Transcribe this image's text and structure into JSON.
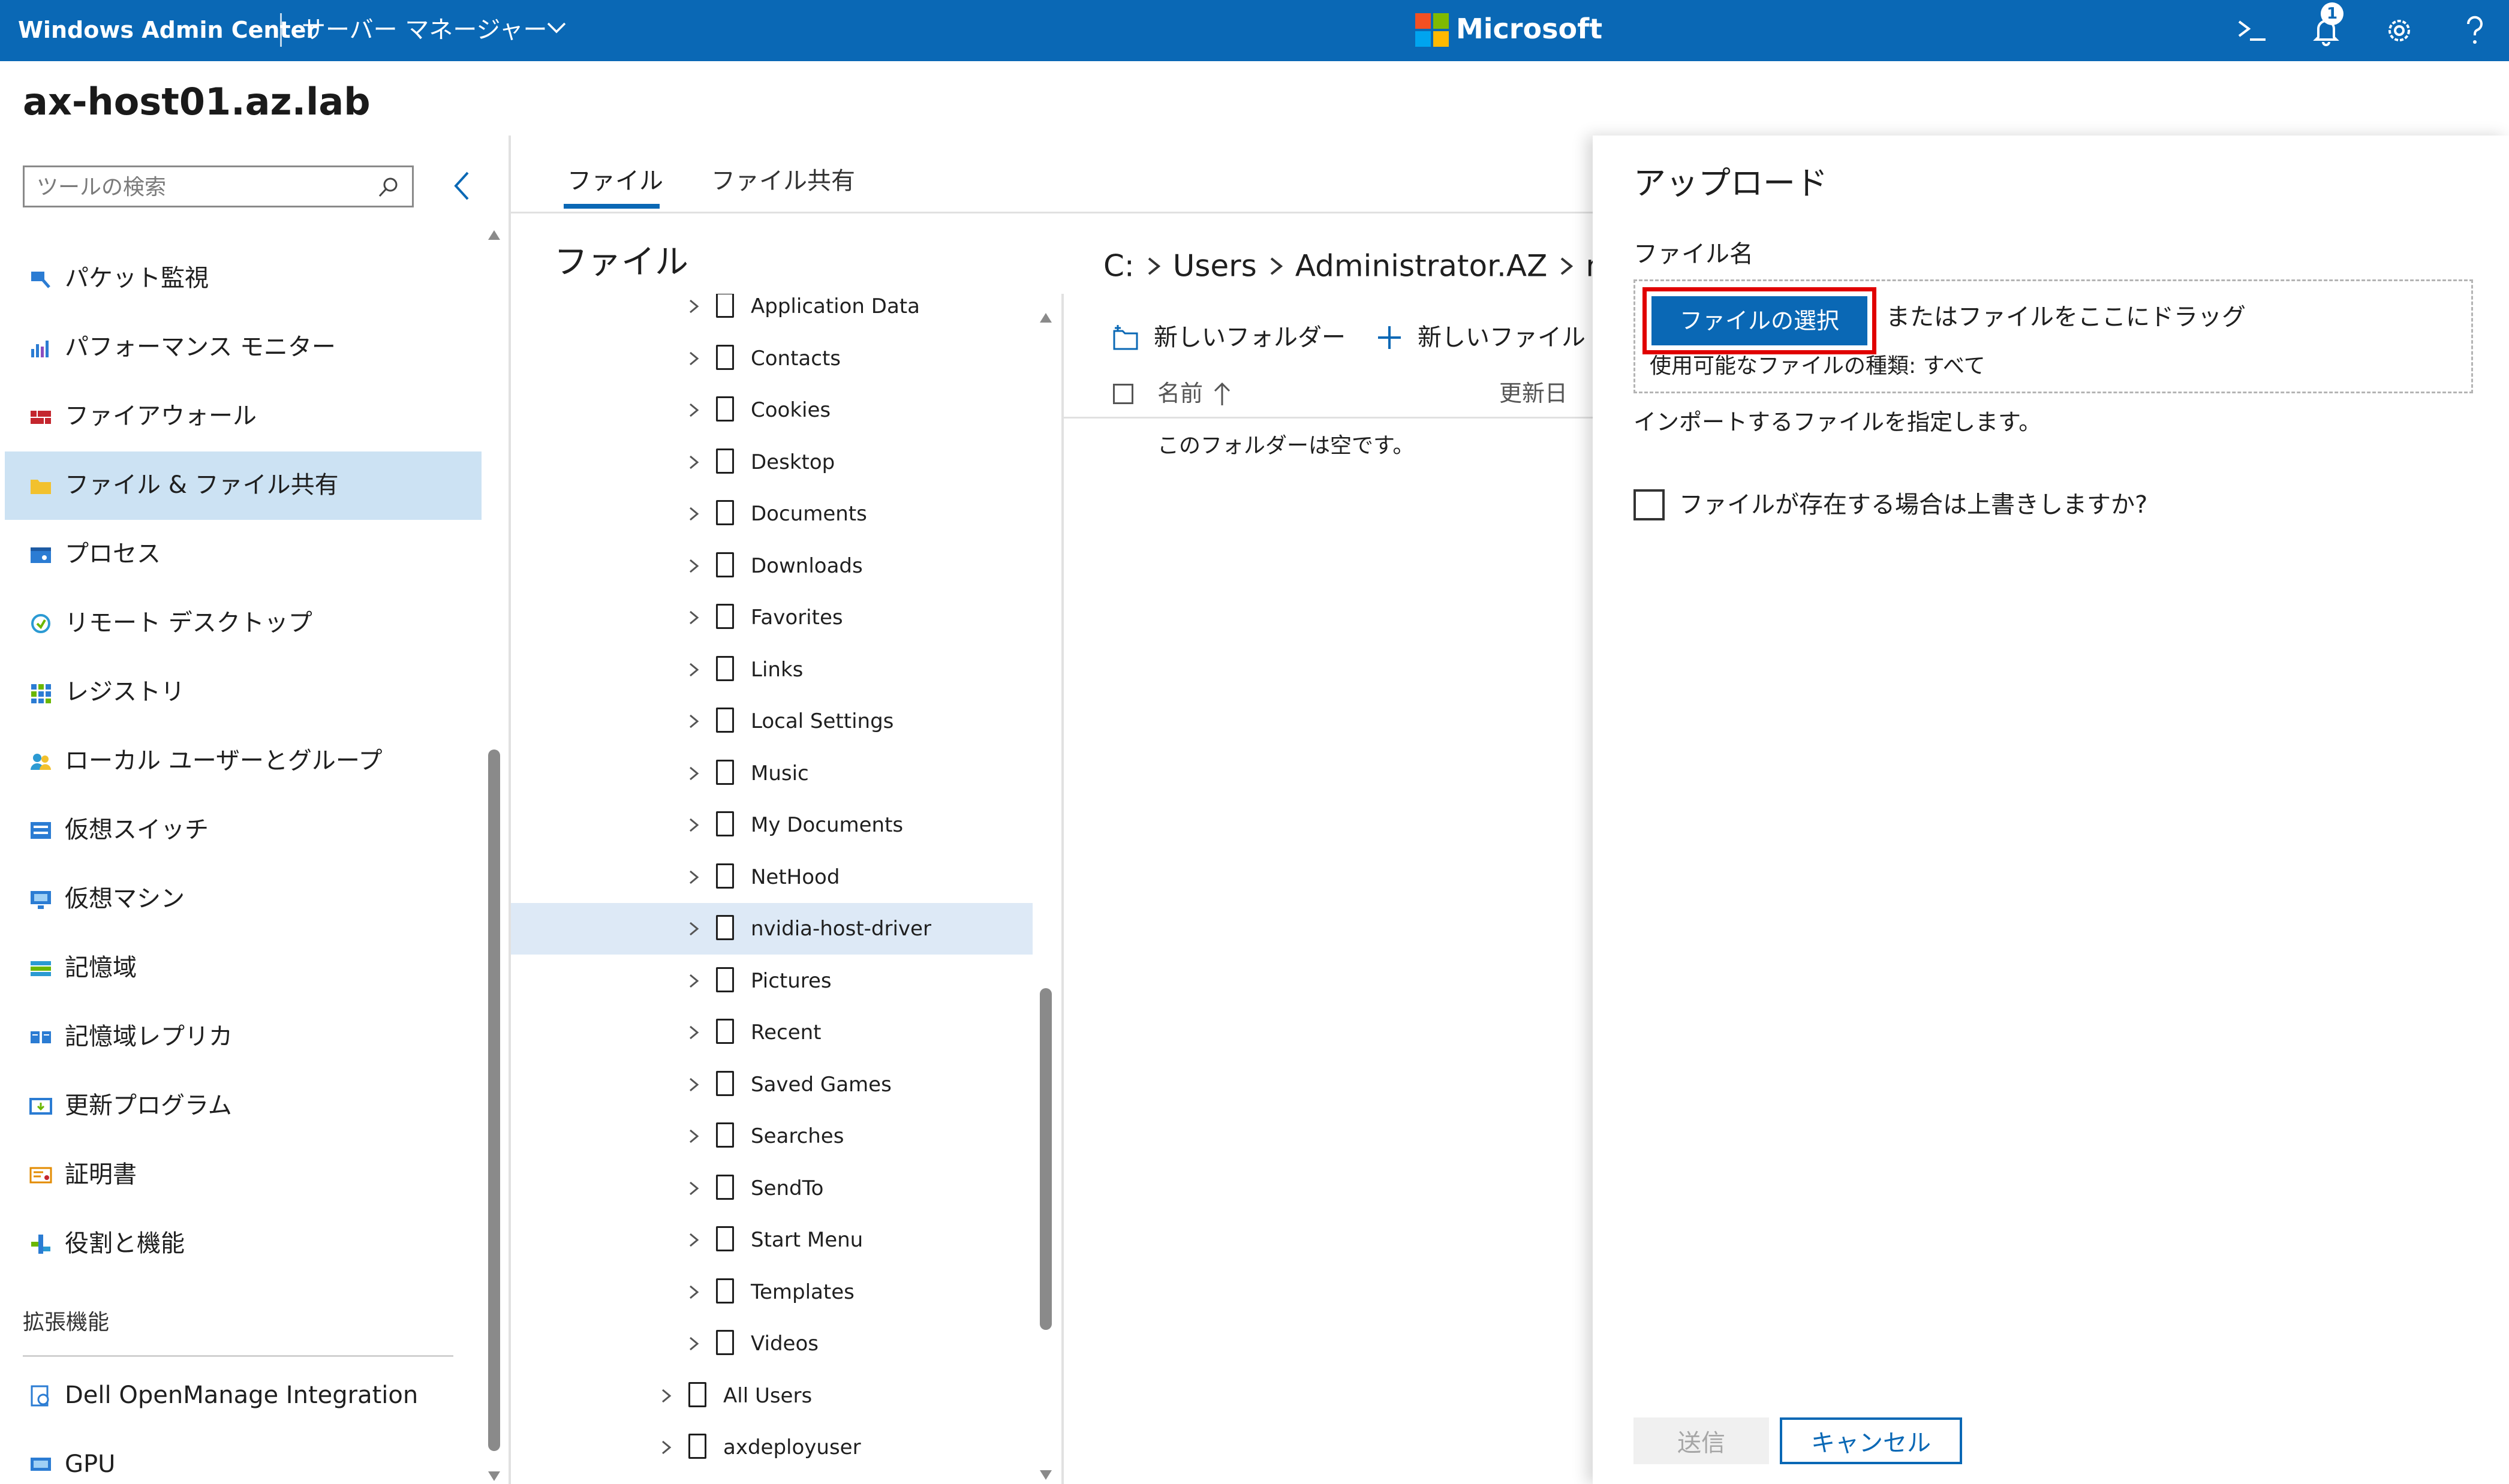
{
  "topbar": {
    "app_title": "Windows Admin Center",
    "context": "サーバー マネージャー",
    "brand": "Microsoft",
    "notification_count": "1",
    "accent": "#0a68b5",
    "icons": [
      "terminal-icon",
      "bell-icon",
      "gear-icon",
      "help-icon"
    ]
  },
  "header": {
    "hostname": "ax-host01.az.lab"
  },
  "sidebar": {
    "search_placeholder": "ツールの検索",
    "items": [
      {
        "label": "パケット監視",
        "icon": "packet-monitor-icon"
      },
      {
        "label": "パフォーマンス モニター",
        "icon": "performance-monitor-icon"
      },
      {
        "label": "ファイアウォール",
        "icon": "firewall-icon"
      },
      {
        "label": "ファイル & ファイル共有",
        "icon": "folder-icon",
        "selected": true
      },
      {
        "label": "プロセス",
        "icon": "process-icon"
      },
      {
        "label": "リモート デスクトップ",
        "icon": "remote-desktop-icon"
      },
      {
        "label": "レジストリ",
        "icon": "registry-icon"
      },
      {
        "label": "ローカル ユーザーとグループ",
        "icon": "users-icon"
      },
      {
        "label": "仮想スイッチ",
        "icon": "virtual-switch-icon"
      },
      {
        "label": "仮想マシン",
        "icon": "virtual-machine-icon"
      },
      {
        "label": "記憶域",
        "icon": "storage-icon"
      },
      {
        "label": "記憶域レプリカ",
        "icon": "storage-replica-icon"
      },
      {
        "label": "更新プログラム",
        "icon": "updates-icon"
      },
      {
        "label": "証明書",
        "icon": "certificate-icon"
      },
      {
        "label": "役割と機能",
        "icon": "roles-features-icon"
      }
    ],
    "extensions_heading": "拡張機能",
    "extensions": [
      {
        "label": "Dell OpenManage Integration",
        "icon": "dell-icon"
      },
      {
        "label": "GPU",
        "icon": "gpu-icon"
      }
    ]
  },
  "tabs": [
    {
      "label": "ファイル",
      "active": true
    },
    {
      "label": "ファイル共有",
      "active": false
    }
  ],
  "files_pane": {
    "title": "ファイル",
    "tree": [
      {
        "label": "Application Data",
        "level": 2
      },
      {
        "label": "Contacts",
        "level": 2
      },
      {
        "label": "Cookies",
        "level": 2
      },
      {
        "label": "Desktop",
        "level": 2
      },
      {
        "label": "Documents",
        "level": 2
      },
      {
        "label": "Downloads",
        "level": 2
      },
      {
        "label": "Favorites",
        "level": 2
      },
      {
        "label": "Links",
        "level": 2
      },
      {
        "label": "Local Settings",
        "level": 2
      },
      {
        "label": "Music",
        "level": 2
      },
      {
        "label": "My Documents",
        "level": 2
      },
      {
        "label": "NetHood",
        "level": 2
      },
      {
        "label": "nvidia-host-driver",
        "level": 2,
        "selected": true
      },
      {
        "label": "Pictures",
        "level": 2
      },
      {
        "label": "Recent",
        "level": 2
      },
      {
        "label": "Saved Games",
        "level": 2
      },
      {
        "label": "Searches",
        "level": 2
      },
      {
        "label": "SendTo",
        "level": 2
      },
      {
        "label": "Start Menu",
        "level": 2
      },
      {
        "label": "Templates",
        "level": 2
      },
      {
        "label": "Videos",
        "level": 2
      },
      {
        "label": "All Users",
        "level": 1
      },
      {
        "label": "axdeployuser",
        "level": 1
      }
    ]
  },
  "main": {
    "breadcrumb": [
      "C:",
      "Users",
      "Administrator.AZ",
      "nvi"
    ],
    "new_folder": "新しいフォルダー",
    "new_file": "新しいファイル",
    "col_name": "名前",
    "col_modified": "更新日",
    "empty_message": "このフォルダーは空です。"
  },
  "upload_panel": {
    "title": "アップロード",
    "file_name_label": "ファイル名",
    "choose_button": "ファイルの選択",
    "drag_text": "またはファイルをここにドラッグ",
    "file_types": "使用可能なファイルの種類: すべて",
    "help_text": "インポートするファイルを指定します。",
    "overwrite_label": "ファイルが存在する場合は上書きしますか?",
    "overwrite_checked": false,
    "submit_label": "送信",
    "cancel_label": "キャンセル",
    "highlight_color": "#e00000"
  }
}
